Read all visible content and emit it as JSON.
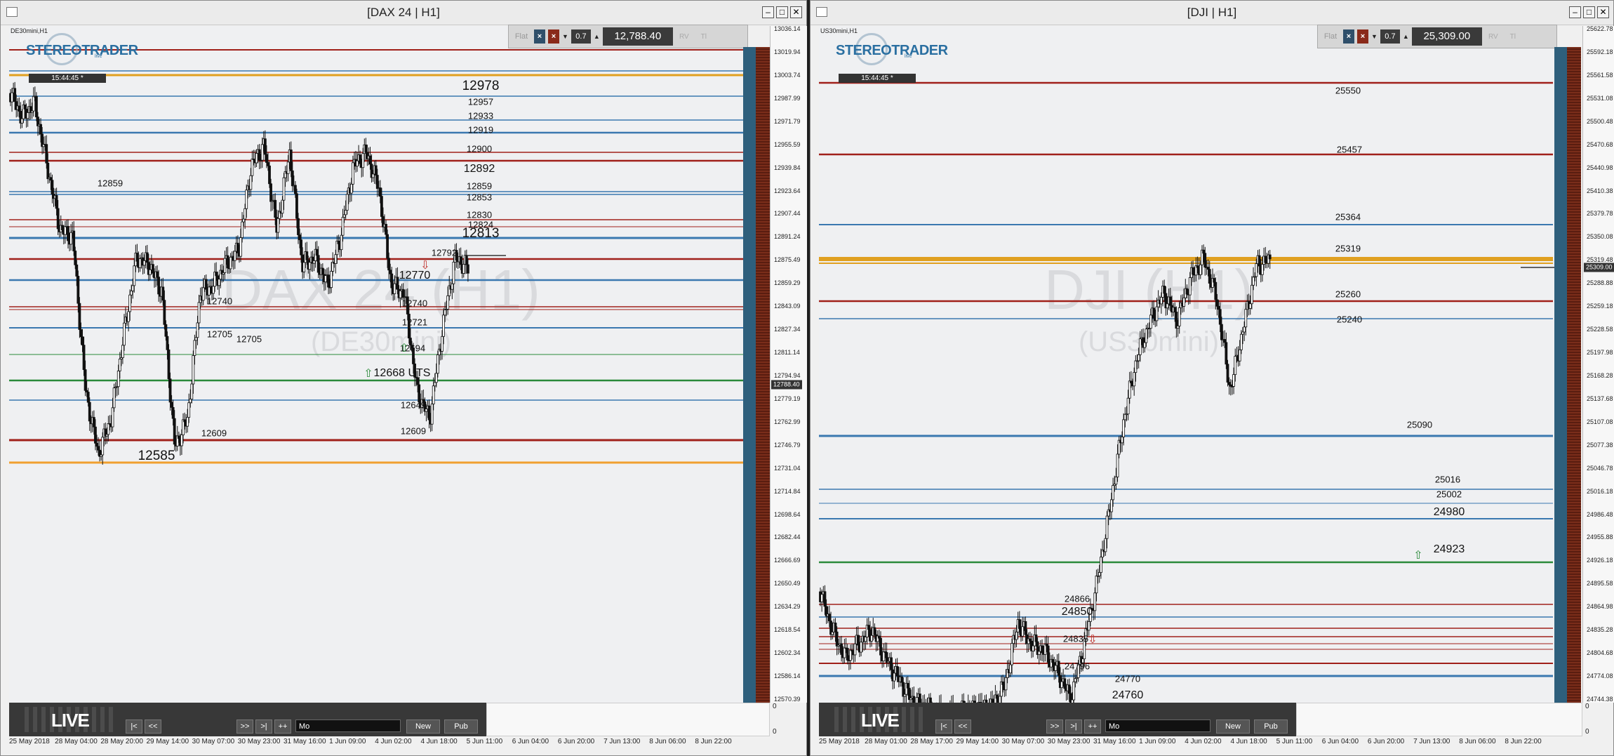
{
  "left": {
    "title": "[DAX 24 | H1]",
    "info": "DE30mini,H1",
    "logo": "STEREOTRADER",
    "logo_sub": "live",
    "time": "15:44:45 *",
    "watermark": "DAX 24 (H1)",
    "watermark_sub": "(DE30mini)",
    "toolbar": {
      "flat": "Flat",
      "x1": "×",
      "x2": "×",
      "num": "0.7",
      "price": "12,788.40",
      "rv": "RV",
      "tl": "Tl"
    },
    "current_price_tag": "12788.40",
    "y_ticks": [
      "13036.14",
      "13019.94",
      "13003.74",
      "12987.99",
      "12971.79",
      "12955.59",
      "12939.84",
      "12923.64",
      "12907.44",
      "12891.24",
      "12875.49",
      "12859.29",
      "12843.09",
      "12827.34",
      "12811.14",
      "12794.94",
      "12779.19",
      "12762.99",
      "12746.79",
      "12731.04",
      "12714.84",
      "12698.64",
      "12682.44",
      "12666.69",
      "12650.49",
      "12634.29",
      "12618.54",
      "12602.34",
      "12586.14",
      "12570.39"
    ],
    "x_labels": [
      "25 May 2018",
      "28 May 04:00",
      "28 May 20:00",
      "29 May 14:00",
      "30 May 07:00",
      "30 May 23:00",
      "31 May 16:00",
      "1 Jun 09:00",
      "4 Jun 02:00",
      "4 Jun 18:00",
      "5 Jun 11:00",
      "6 Jun 04:00",
      "6 Jun 20:00",
      "7 Jun 13:00",
      "8 Jun 06:00",
      "8 Jun 22:00"
    ],
    "levels": [
      "12978",
      "12957",
      "12933",
      "12919",
      "12900",
      "12892",
      "12859",
      "12853",
      "12830",
      "12824",
      "12813",
      "12792",
      "12770",
      "12740",
      "12721",
      "12694",
      "12668 UTS",
      "12649",
      "12609",
      "12859",
      "12740",
      "12705",
      "12705",
      "12609",
      "12585"
    ],
    "bottom": {
      "live": "LIVE",
      "first": "|<",
      "prev": "<<",
      "next": ">>",
      "last": ">|",
      "plus": "++",
      "mode": "Mo",
      "new": "New",
      "pub": "Pub",
      "zero": "0"
    }
  },
  "right": {
    "title": "[DJI | H1]",
    "info": "US30mini,H1",
    "logo": "STEREOTRADER",
    "logo_sub": "live",
    "time": "15:44:45 *",
    "watermark": "DJI (H1)",
    "watermark_sub": "(US30mini)",
    "toolbar": {
      "flat": "Flat",
      "x1": "×",
      "x2": "×",
      "num": "0.7",
      "price": "25,309.00",
      "rv": "RV",
      "tl": "Tl"
    },
    "current_price_tag": "25309.00",
    "y_ticks": [
      "25622.78",
      "25592.18",
      "25561.58",
      "25531.08",
      "25500.48",
      "25470.68",
      "25440.98",
      "25410.38",
      "25379.78",
      "25350.08",
      "25319.48",
      "25288.88",
      "25259.18",
      "25228.58",
      "25197.98",
      "25168.28",
      "25137.68",
      "25107.08",
      "25077.38",
      "25046.78",
      "25016.18",
      "24986.48",
      "24955.88",
      "24926.18",
      "24895.58",
      "24864.98",
      "24835.28",
      "24804.68",
      "24774.08",
      "24744.38"
    ],
    "x_labels": [
      "25 May 2018",
      "28 May 01:00",
      "28 May 17:00",
      "29 May 14:00",
      "30 May 07:00",
      "30 May 23:00",
      "31 May 16:00",
      "1 Jun 09:00",
      "4 Jun 02:00",
      "4 Jun 18:00",
      "5 Jun 11:00",
      "6 Jun 04:00",
      "6 Jun 20:00",
      "7 Jun 13:00",
      "8 Jun 06:00",
      "8 Jun 22:00"
    ],
    "levels": [
      "25550",
      "25457",
      "25364",
      "25319",
      "25260",
      "25240",
      "25090",
      "25016",
      "25002",
      "24980",
      "24923",
      "24866",
      "24850",
      "24835",
      "24796",
      "24770",
      "24760"
    ],
    "bottom": {
      "live": "LIVE",
      "first": "|<",
      "prev": "<<",
      "next": ">>",
      "last": ">|",
      "plus": "++",
      "mode": "Mo",
      "new": "New",
      "pub": "Pub",
      "zero": "0"
    }
  },
  "colors": {
    "red_line": "#a0201a",
    "blue_line": "#3a78b0",
    "gold_line": "#e0a020",
    "green_line": "#2a8a3a",
    "orange_line": "#f0a030",
    "candle": "#111111"
  }
}
